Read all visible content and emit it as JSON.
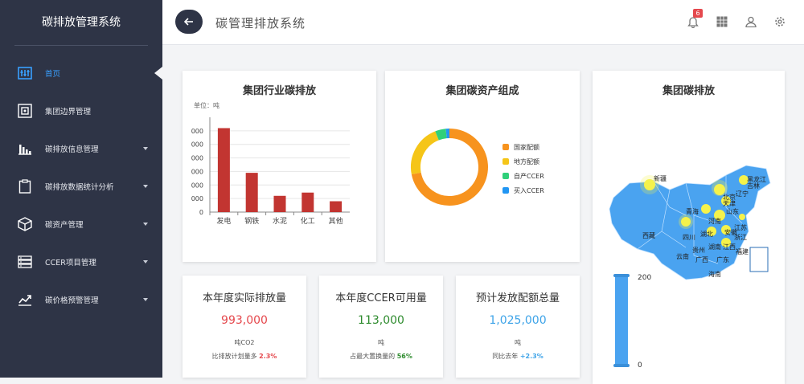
{
  "sidebar": {
    "title": "碳排放管理系统",
    "items": [
      {
        "label": "首页",
        "icon": "dashboard-icon",
        "active": true
      },
      {
        "label": "集团边界管理",
        "icon": "boundary-icon"
      },
      {
        "label": "碳排放信息管理",
        "icon": "bar-chart-icon"
      },
      {
        "label": "碳排放数据统计分析",
        "icon": "clipboard-icon"
      },
      {
        "label": "碳资产管理",
        "icon": "box-icon"
      },
      {
        "label": "CCER项目管理",
        "icon": "server-icon"
      },
      {
        "label": "碳价格预警管理",
        "icon": "trend-icon"
      }
    ]
  },
  "header": {
    "title": "碳管理排放系统",
    "notification_count": "6"
  },
  "industry_card": {
    "title": "集团行业碳排放",
    "unit_label": "单位：吨"
  },
  "asset_card": {
    "title": "集团碳资产组成",
    "legend": [
      "国家配额",
      "地方配额",
      "自产CCER",
      "买入CCER"
    ]
  },
  "map_card": {
    "title": "集团碳排放",
    "scale_max": "200",
    "scale_min": "0",
    "place_labels": [
      "新疆",
      "黑龙江",
      "吉林",
      "辽宁",
      "北京",
      "天津",
      "青海",
      "山东",
      "西藏",
      "河南",
      "江苏",
      "安徽",
      "湖北",
      "浙江",
      "四川",
      "云南",
      "贵州",
      "湖南",
      "江西",
      "福建",
      "广东",
      "广西",
      "海南"
    ]
  },
  "stats": [
    {
      "title": "本年度实际排放量",
      "value": "993,000",
      "unit": "吨CO2",
      "note": "比排放计划量多",
      "note_value": "2.3%"
    },
    {
      "title": "本年度CCER可用量",
      "value": "113,000",
      "unit": "吨",
      "note": "占最大置换量的",
      "note_value": "56%"
    },
    {
      "title": "预计发放配额总量",
      "value": "1,025,000",
      "unit": "吨",
      "note": "同比去年",
      "note_value": "+2.3%"
    }
  ],
  "colors": {
    "sidebar_bg": "#2e3446",
    "active": "#39a0ff",
    "bar": "#c23531",
    "stat_red": "#e5484d",
    "stat_green": "#2e8b2e",
    "stat_blue": "#3da3e8"
  },
  "chart_data": [
    {
      "type": "bar",
      "title": "集团行业碳排放",
      "categories": [
        "发电",
        "钢铁",
        "水泥",
        "化工",
        "其他"
      ],
      "values": [
        3100,
        1450,
        600,
        720,
        400
      ],
      "ylim": [
        0,
        3500
      ],
      "yticks_visible": [
        "000",
        "000",
        "000",
        "000",
        "000",
        "000",
        "0"
      ],
      "grid": true
    },
    {
      "type": "pie",
      "title": "集团碳资产组成",
      "labels": [
        "国家配额",
        "地方配额",
        "自产CCER",
        "买入CCER"
      ],
      "values": [
        72,
        22,
        4.5,
        1.5
      ],
      "colors": [
        "#f7931e",
        "#f5c518",
        "#2fd07a",
        "#2196f3"
      ],
      "legend": "right"
    }
  ]
}
